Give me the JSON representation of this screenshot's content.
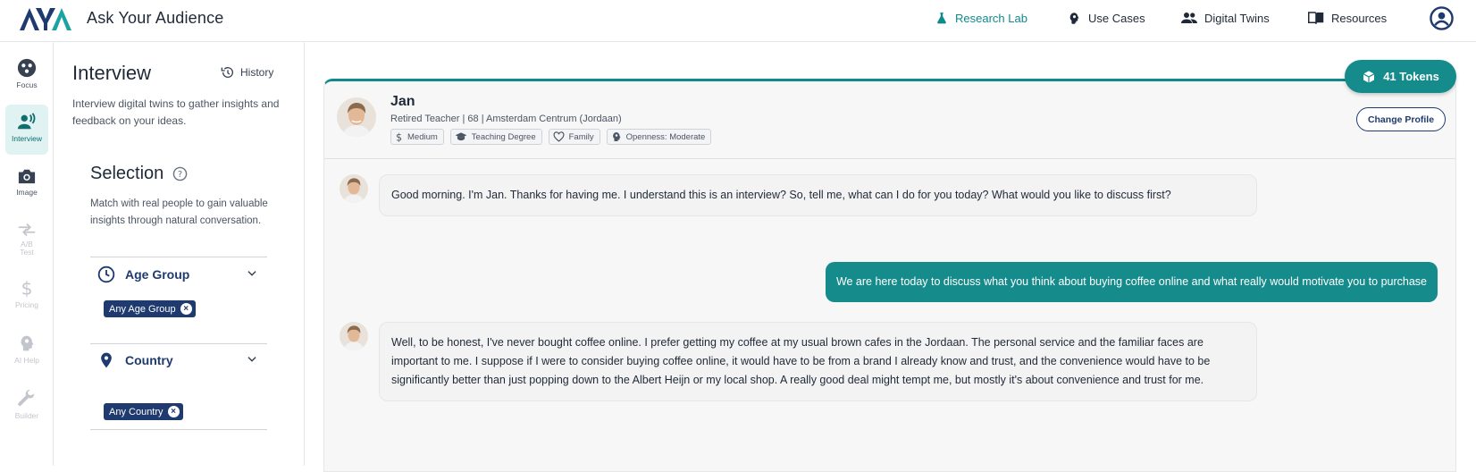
{
  "app": {
    "title": "Ask Your Audience",
    "logo_text": "AYA"
  },
  "nav": {
    "research_lab": "Research Lab",
    "use_cases": "Use Cases",
    "digital_twins": "Digital Twins",
    "resources": "Resources"
  },
  "rail": {
    "focus": "Focus",
    "interview": "Interview",
    "image": "Image",
    "ab_test_line1": "A/B",
    "ab_test_line2": "Test",
    "pricing": "Pricing",
    "ai_help": "AI Help",
    "builder": "Builder"
  },
  "panel": {
    "title": "Interview",
    "history": "History",
    "description": "Interview digital twins to gather insights and feedback on your ideas.",
    "selection_title": "Selection",
    "selection_desc": "Match with real people to gain valuable insights through natural conversation.",
    "filters": [
      {
        "label": "Age Group",
        "chip": "Any Age Group"
      },
      {
        "label": "Country",
        "chip": "Any Country"
      }
    ]
  },
  "tokens": {
    "label": "41 Tokens"
  },
  "persona": {
    "name": "Jan",
    "subtitle": "Retired Teacher | 68 | Amsterdam Centrum (Jordaan)",
    "tags": [
      "Medium",
      "Teaching Degree",
      "Family",
      "Openness: Moderate"
    ],
    "change_profile": "Change Profile"
  },
  "messages": [
    {
      "role": "persona",
      "text": "Good morning.  I'm Jan.  Thanks for having me. I understand this is an interview?  So, tell me, what can I do for you today? What would you like to discuss first?"
    },
    {
      "role": "user",
      "text": "We are here today to discuss what you think about buying coffee online and what really would motivate you to purchase"
    },
    {
      "role": "persona",
      "text": "Well, to be honest, I've never bought coffee online.  I prefer getting my coffee at my usual brown cafes in the Jordaan.  The personal service and the familiar faces are important to me.  I suppose if I were to consider buying coffee online, it would have to be from a brand I already know and trust, and the convenience would have to be significantly better than just popping down to the Albert Heijn or my local shop.  A really good deal might tempt me, but mostly it's about convenience and trust for me."
    }
  ],
  "colors": {
    "accent": "#168b8b",
    "navy": "#1e3a6e"
  }
}
